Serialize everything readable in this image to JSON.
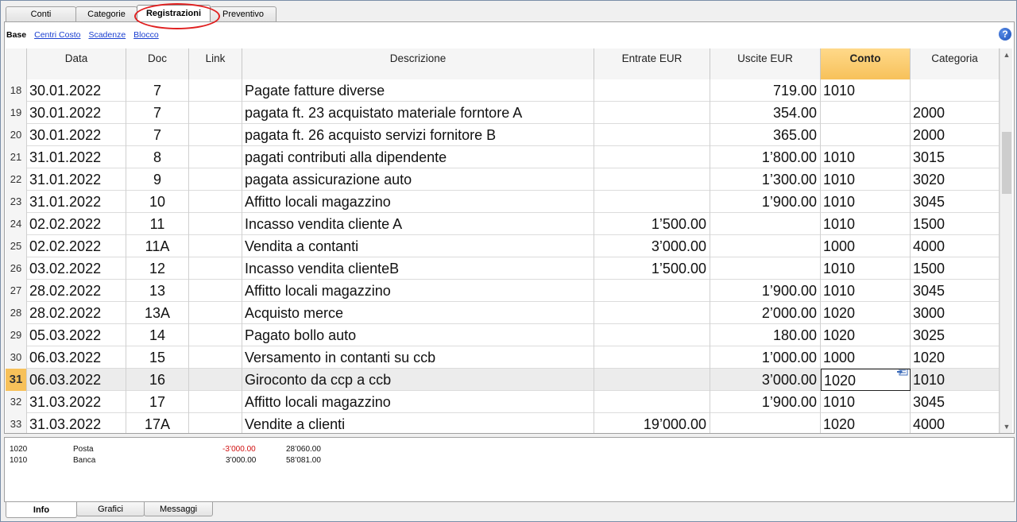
{
  "top_tabs": [
    "Conti",
    "Categorie",
    "Registrazioni",
    "Preventivo"
  ],
  "active_tab": "Registrazioni",
  "views": {
    "base": "Base",
    "centri_costo": "Centri Costo",
    "scadenze": "Scadenze",
    "blocco": "Blocco"
  },
  "help_icon": "?",
  "columns": [
    "Data",
    "Doc",
    "Link",
    "Descrizione",
    "Entrate EUR",
    "Uscite EUR",
    "Conto",
    "Categoria"
  ],
  "selected_column": "Conto",
  "rows": [
    {
      "n": "18",
      "data": "30.01.2022",
      "doc": "7",
      "link": "",
      "desc": "Pagate fatture diverse",
      "entrate": "",
      "uscite": "719.00",
      "conto": "1010",
      "cat": ""
    },
    {
      "n": "19",
      "data": "30.01.2022",
      "doc": "7",
      "link": "",
      "desc": "pagata ft. 23 acquistato materiale forntore A",
      "entrate": "",
      "uscite": "354.00",
      "conto": "",
      "cat": "2000"
    },
    {
      "n": "20",
      "data": "30.01.2022",
      "doc": "7",
      "link": "",
      "desc": "pagata ft. 26 acquisto servizi fornitore B",
      "entrate": "",
      "uscite": "365.00",
      "conto": "",
      "cat": "2000"
    },
    {
      "n": "21",
      "data": "31.01.2022",
      "doc": "8",
      "link": "",
      "desc": "pagati contributi alla dipendente",
      "entrate": "",
      "uscite": "1’800.00",
      "conto": "1010",
      "cat": "3015"
    },
    {
      "n": "22",
      "data": "31.01.2022",
      "doc": "9",
      "link": "",
      "desc": "pagata assicurazione auto",
      "entrate": "",
      "uscite": "1’300.00",
      "conto": "1010",
      "cat": "3020"
    },
    {
      "n": "23",
      "data": "31.01.2022",
      "doc": "10",
      "link": "",
      "desc": "Affitto locali magazzino",
      "entrate": "",
      "uscite": "1’900.00",
      "conto": "1010",
      "cat": "3045"
    },
    {
      "n": "24",
      "data": "02.02.2022",
      "doc": "11",
      "link": "",
      "desc": "Incasso vendita cliente A",
      "entrate": "1’500.00",
      "uscite": "",
      "conto": "1010",
      "cat": "1500"
    },
    {
      "n": "25",
      "data": "02.02.2022",
      "doc": "11A",
      "link": "",
      "desc": "Vendita a contanti",
      "entrate": "3’000.00",
      "uscite": "",
      "conto": "1000",
      "cat": "4000"
    },
    {
      "n": "26",
      "data": "03.02.2022",
      "doc": "12",
      "link": "",
      "desc": "Incasso vendita clienteB",
      "entrate": "1’500.00",
      "uscite": "",
      "conto": "1010",
      "cat": "1500"
    },
    {
      "n": "27",
      "data": "28.02.2022",
      "doc": "13",
      "link": "",
      "desc": "Affitto locali magazzino",
      "entrate": "",
      "uscite": "1’900.00",
      "conto": "1010",
      "cat": "3045"
    },
    {
      "n": "28",
      "data": "28.02.2022",
      "doc": "13A",
      "link": "",
      "desc": "Acquisto merce",
      "entrate": "",
      "uscite": "2’000.00",
      "conto": "1020",
      "cat": "3000"
    },
    {
      "n": "29",
      "data": "05.03.2022",
      "doc": "14",
      "link": "",
      "desc": "Pagato bollo auto",
      "entrate": "",
      "uscite": "180.00",
      "conto": "1020",
      "cat": "3025"
    },
    {
      "n": "30",
      "data": "06.03.2022",
      "doc": "15",
      "link": "",
      "desc": "Versamento in contanti su ccb",
      "entrate": "",
      "uscite": "1’000.00",
      "conto": "1000",
      "cat": "1020"
    },
    {
      "n": "31",
      "data": "06.03.2022",
      "doc": "16",
      "link": "",
      "desc": "Giroconto da ccp a ccb",
      "entrate": "",
      "uscite": "3’000.00",
      "conto": "1020",
      "cat": "1010",
      "current": true
    },
    {
      "n": "32",
      "data": "31.03.2022",
      "doc": "17",
      "link": "",
      "desc": "Affitto locali magazzino",
      "entrate": "",
      "uscite": "1’900.00",
      "conto": "1010",
      "cat": "3045"
    },
    {
      "n": "33",
      "data": "31.03.2022",
      "doc": "17A",
      "link": "",
      "desc": "Vendite a clienti",
      "entrate": "19’000.00",
      "uscite": "",
      "conto": "1020",
      "cat": "4000"
    }
  ],
  "info": [
    {
      "account": "1020",
      "name": "Posta",
      "amount": "-3’000.00",
      "balance": "28’060.00",
      "negative": true
    },
    {
      "account": "1010",
      "name": "Banca",
      "amount": "3’000.00",
      "balance": "58’081.00",
      "negative": false
    }
  ],
  "bottom_tabs": [
    "Info",
    "Grafici",
    "Messaggi"
  ],
  "active_bottom_tab": "Info",
  "colors": {
    "selected_header": "#f7c15a",
    "highlight_circle": "#e02020",
    "link": "#1a3fd0",
    "negative": "#d01010"
  }
}
